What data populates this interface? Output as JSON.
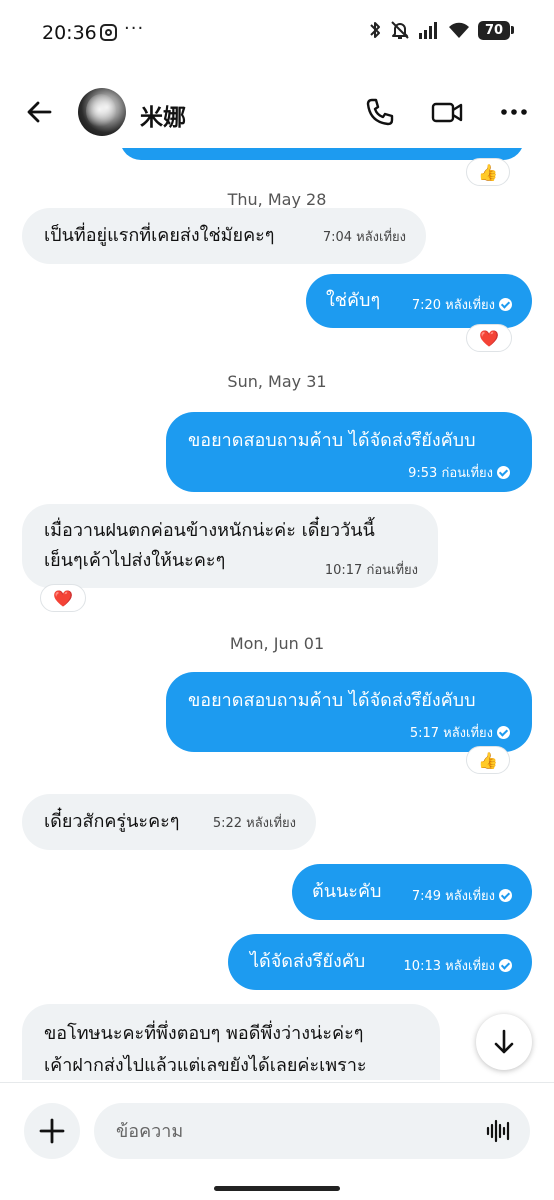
{
  "status_bar": {
    "time": "20:36",
    "overflow_dots": "···",
    "battery": "70",
    "icons": [
      "instagram-notification-icon",
      "bluetooth-icon",
      "mute-bell-icon",
      "signal-icon",
      "wifi-icon",
      "battery-icon"
    ]
  },
  "header": {
    "contact_name": "米娜",
    "icons": [
      "back-arrow-icon",
      "avatar",
      "phone-call-icon",
      "video-call-icon",
      "more-options-icon"
    ]
  },
  "messages": {
    "top_partial": {
      "reaction": "👍"
    },
    "sep1": "Thu, May 28",
    "m1": {
      "text": "เป็นที่อยู่แรกที่เคยส่งใช่มัยคะๆ",
      "time": "7:04 หลังเที่ยง"
    },
    "m2": {
      "text": "ใช่คับๆ",
      "time": "7:20 หลังเที่ยง",
      "reaction": "❤️"
    },
    "sep2": "Sun, May 31",
    "m3": {
      "text": "ขอยาดสอบถามค้าบ ได้จัดส่งรึยังคับบ",
      "time": "9:53 ก่อนเที่ยง"
    },
    "m4": {
      "line1": "เมื่อวานฝนตกค่อนข้างหนักน่ะค่ะ เดี๋ยววันนี้",
      "line2": "เย็นๆเค้าไปส่งให้นะคะๆ",
      "time": "10:17 ก่อนเที่ยง",
      "reaction": "❤️"
    },
    "sep3": "Mon, Jun 01",
    "m5": {
      "text": "ขอยาดสอบถามค้าบ ได้จัดส่งรึยังคับบ",
      "time": "5:17 หลังเที่ยง",
      "reaction": "👍"
    },
    "m6": {
      "text": "เดี๋ยวสักครู่นะคะๆ",
      "time": "5:22 หลังเที่ยง"
    },
    "m7": {
      "text": "ต้นนะคับ",
      "time": "7:49 หลังเที่ยง"
    },
    "m8": {
      "text": "ได้จัดส่งรึยังคับ",
      "time": "10:13 หลังเที่ยง"
    },
    "m9": {
      "line1": "ขอโทษนะคะที่พึ่งตอบๆ พอดีพึ่งว่างน่ะค่ะๆ",
      "line2": "เค้าฝากส่งไปแล้วแต่เลขยังได้เลยค่ะเพราะ"
    }
  },
  "composer": {
    "placeholder": "ข้อความ",
    "icons": [
      "add-plus-icon",
      "voice-waveform-icon"
    ]
  },
  "colors": {
    "accent": "#1d9bf0",
    "incoming_bubble": "#eff2f4",
    "heart": "#e0245e"
  }
}
